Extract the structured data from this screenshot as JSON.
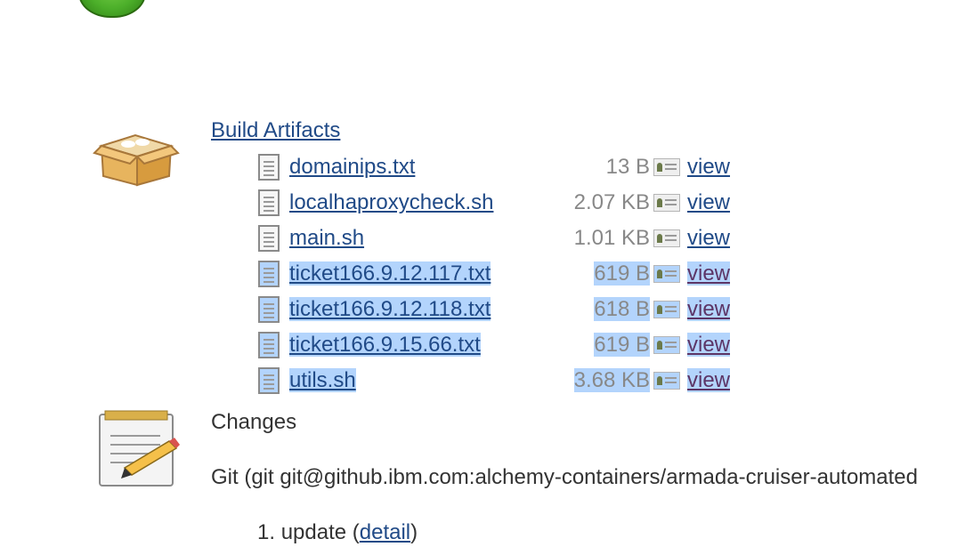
{
  "artifacts": {
    "title": "Build Artifacts",
    "files": [
      {
        "name": "domainips.txt",
        "size": "13 B",
        "view": "view",
        "selected": false
      },
      {
        "name": "localhaproxycheck.sh",
        "size": "2.07 KB",
        "view": "view",
        "selected": false
      },
      {
        "name": "main.sh",
        "size": "1.01 KB",
        "view": "view",
        "selected": false
      },
      {
        "name": "ticket166.9.12.117.txt",
        "size": "619 B",
        "view": "view",
        "selected": true
      },
      {
        "name": "ticket166.9.12.118.txt",
        "size": "618 B",
        "view": "view",
        "selected": true
      },
      {
        "name": "ticket166.9.15.66.txt",
        "size": "619 B",
        "view": "view",
        "selected": true
      },
      {
        "name": "utils.sh",
        "size": "3.68 KB",
        "view": "view",
        "selected": true
      }
    ]
  },
  "changes": {
    "title": "Changes",
    "git_text": "Git (git git@github.ibm.com:alchemy-containers/armada-cruiser-automated",
    "items": [
      {
        "number": "1.",
        "text": "update",
        "detail_link": "detail"
      }
    ]
  },
  "icons": {
    "status": "status-ball-icon",
    "artifacts": "package-box-icon",
    "changes": "notepad-pencil-icon",
    "file": "text-file-icon",
    "view": "view-document-icon"
  },
  "colors": {
    "link": "#204a87",
    "visited_link": "#5c3566",
    "selection": "#b3d4fc",
    "size_text": "#888888"
  }
}
